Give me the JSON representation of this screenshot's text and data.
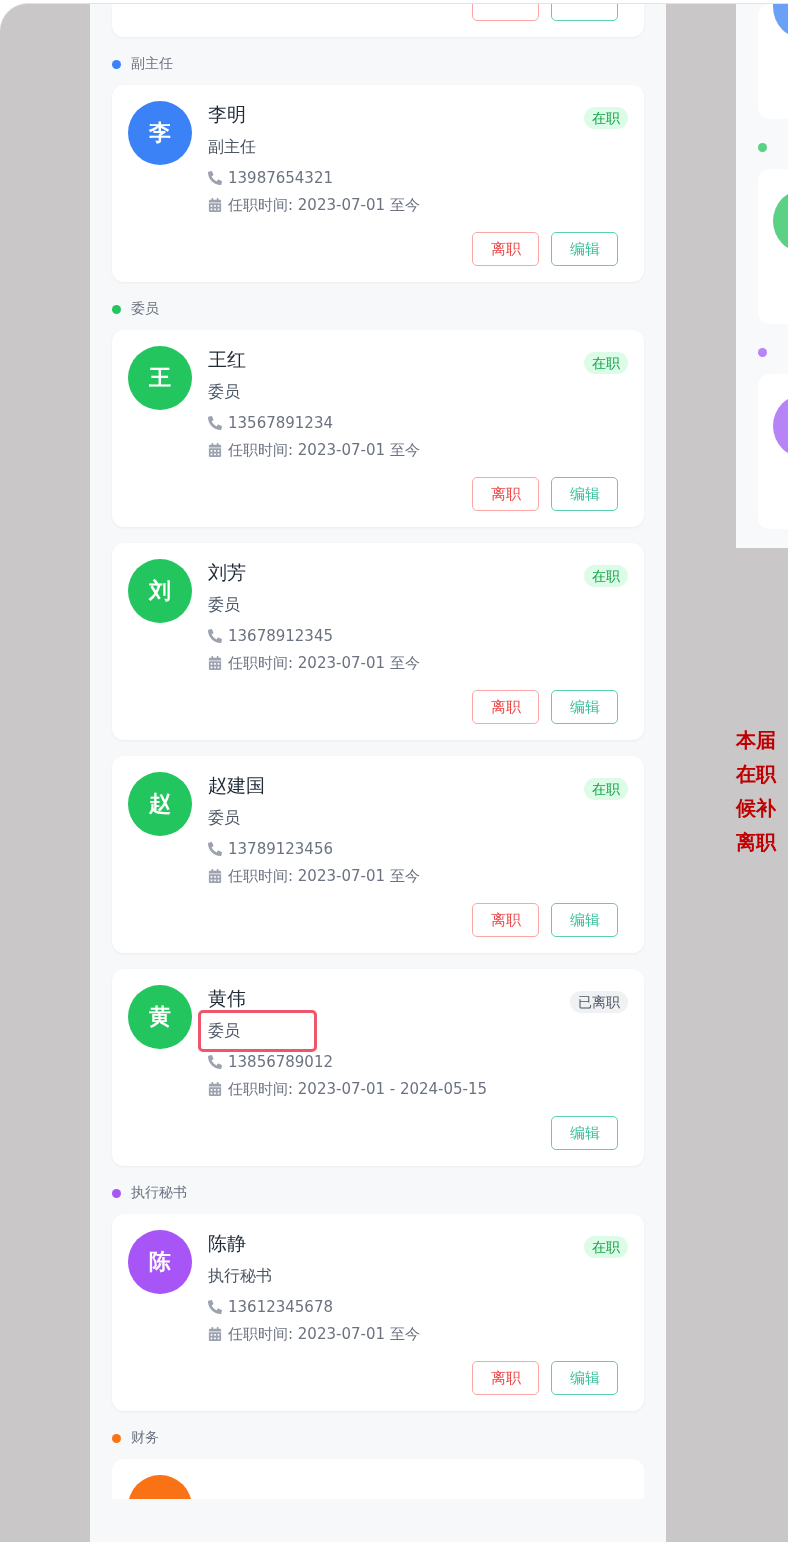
{
  "partial_card_top": {
    "actions": [
      {
        "kind": "resign"
      },
      {
        "kind": "edit"
      }
    ]
  },
  "sections": [
    {
      "title": "副主任",
      "color": "#3b82f6",
      "members": [
        {
          "avatar": "李",
          "name": "李明",
          "role": "副主任",
          "highlighted": false,
          "status": "在职",
          "active": true,
          "phone": "13987654321",
          "tenure": "任职时间: 2023-07-01 至今",
          "actions": [
            {
              "kind": "resign",
              "label": "离职"
            },
            {
              "kind": "edit",
              "label": "编辑"
            }
          ]
        }
      ]
    },
    {
      "title": "委员",
      "color": "#22c55e",
      "members": [
        {
          "avatar": "王",
          "name": "王红",
          "role": "委员",
          "highlighted": false,
          "status": "在职",
          "active": true,
          "phone": "13567891234",
          "tenure": "任职时间: 2023-07-01 至今",
          "actions": [
            {
              "kind": "resign",
              "label": "离职"
            },
            {
              "kind": "edit",
              "label": "编辑"
            }
          ]
        },
        {
          "avatar": "刘",
          "name": "刘芳",
          "role": "委员",
          "highlighted": false,
          "status": "在职",
          "active": true,
          "phone": "13678912345",
          "tenure": "任职时间: 2023-07-01 至今",
          "actions": [
            {
              "kind": "resign",
              "label": "离职"
            },
            {
              "kind": "edit",
              "label": "编辑"
            }
          ]
        },
        {
          "avatar": "赵",
          "name": "赵建国",
          "role": "委员",
          "highlighted": false,
          "status": "在职",
          "active": true,
          "phone": "13789123456",
          "tenure": "任职时间: 2023-07-01 至今",
          "actions": [
            {
              "kind": "resign",
              "label": "离职"
            },
            {
              "kind": "edit",
              "label": "编辑"
            }
          ]
        },
        {
          "avatar": "黄",
          "name": "黄伟",
          "role": "委员",
          "highlighted": true,
          "status": "已离职",
          "active": false,
          "phone": "13856789012",
          "tenure": "任职时间: 2023-07-01 - 2024-05-15",
          "actions": [
            {
              "kind": "edit",
              "label": "编辑"
            }
          ]
        }
      ]
    },
    {
      "title": "执行秘书",
      "color": "#a855f7",
      "members": [
        {
          "avatar": "陈",
          "name": "陈静",
          "role": "执行秘书",
          "highlighted": false,
          "status": "在职",
          "active": true,
          "phone": "13612345678",
          "tenure": "任职时间: 2023-07-01 至今",
          "actions": [
            {
              "kind": "resign",
              "label": "离职"
            },
            {
              "kind": "edit",
              "label": "编辑"
            }
          ]
        }
      ]
    },
    {
      "title": "财务",
      "color": "#f97316",
      "cut_off": true
    }
  ],
  "side_preview": {
    "cards": [
      {
        "color": "#6ba0f7",
        "header": false
      },
      {
        "color": "#5ad184",
        "header": true
      },
      {
        "color": "#b784f6",
        "header": true
      }
    ]
  },
  "notes": [
    "本届",
    "在职",
    "候补",
    "离职"
  ]
}
